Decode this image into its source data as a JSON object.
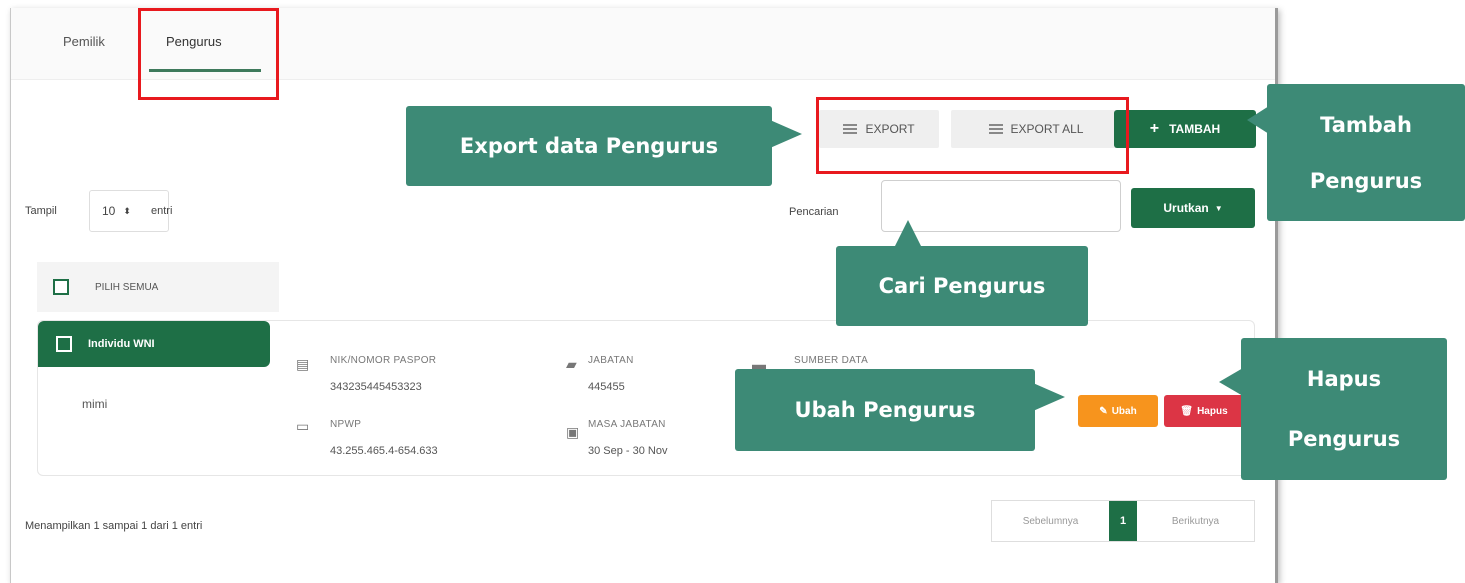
{
  "tabs": [
    {
      "label": "Pemilik"
    },
    {
      "label": "Pengurus"
    }
  ],
  "toolbar": {
    "export_label": "EXPORT",
    "export_all_label": "EXPORT ALL",
    "tambah_label": "TAMBAH",
    "tambah_icon": "plus-icon",
    "export_icon": "menu-icon"
  },
  "controls": {
    "tampil_label": "Tampil",
    "page_size_value": "10",
    "entri_label": "entri",
    "pencarian_label": "Pencarian",
    "search_value": "",
    "urutkan_label": "Urutkan"
  },
  "pilih_semua_label": "PILIH SEMUA",
  "card": {
    "type_label": "Individu WNI",
    "name": "mimi",
    "fields": {
      "nik_label": "NIK/NOMOR PASPOR",
      "nik_value": "343235445453323",
      "npwp_label": "NPWP",
      "npwp_value": "43.255.465.4-654.633",
      "jabatan_label": "JABATAN",
      "jabatan_value": "445455",
      "masa_label": "MASA JABATAN",
      "masa_value": "30 Sep - 30 Nov",
      "sumber_label": "SUMBER DATA"
    },
    "ubah_label": "Ubah",
    "hapus_label": "Hapus"
  },
  "footer": {
    "info": "Menampilkan 1 sampai 1 dari 1 entri",
    "prev_label": "Sebelumnya",
    "current_page": "1",
    "next_label": "Berikutnya"
  },
  "callouts": {
    "export": "Export data Pengurus",
    "tambah_line1": "Tambah",
    "tambah_line2": "Pengurus",
    "cari": "Cari Pengurus",
    "ubah": "Ubah Pengurus",
    "hapus_line1": "Hapus",
    "hapus_line2": "Pengurus"
  },
  "colors": {
    "primary_green": "#1e6f46",
    "callout_teal": "#3d8a76",
    "highlight_red": "#e8191e",
    "ubah_orange": "#f7941d",
    "hapus_red": "#dc3545"
  }
}
